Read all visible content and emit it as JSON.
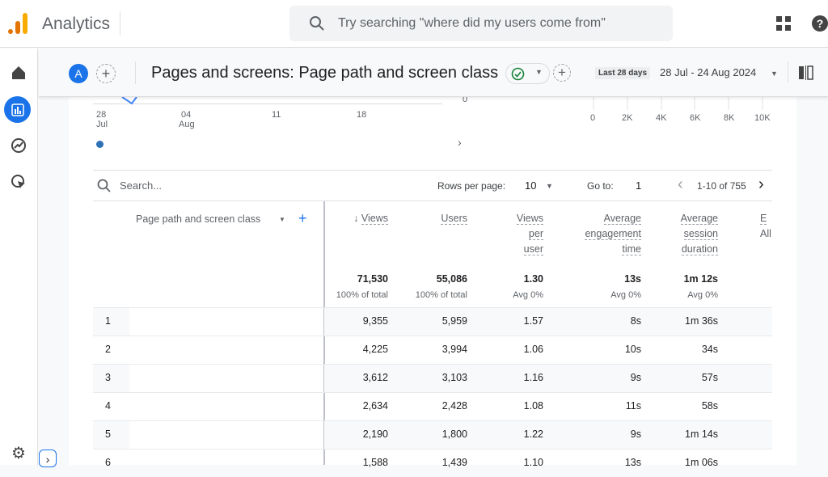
{
  "app": {
    "name": "Analytics",
    "search_placeholder": "Try searching \"where did my users come from\""
  },
  "subheader": {
    "avatar": "A",
    "title": "Pages and screens: Page path and screen class",
    "date_chip": "Last 28 days",
    "date_range": "28 Jul - 24 Aug 2024"
  },
  "chart": {
    "x_ticks": [
      "28",
      "Jul",
      "04",
      "Aug",
      "11",
      "18"
    ],
    "y_zero": "0",
    "bar_ticks": [
      "0",
      "2K",
      "4K",
      "6K",
      "8K",
      "10K"
    ]
  },
  "table": {
    "search_placeholder": "Search...",
    "rows_per_page_label": "Rows per page:",
    "rows_per_page": "10",
    "goto_label": "Go to:",
    "goto": "1",
    "pagination": "1-10 of 755",
    "dimension_header": "Page path and screen class",
    "headers": [
      [
        "Views"
      ],
      [
        "Users"
      ],
      [
        "Views",
        "per",
        "user"
      ],
      [
        "Average",
        "engagement",
        "time"
      ],
      [
        "Average",
        "session",
        "duration"
      ],
      [
        "E",
        "All"
      ]
    ],
    "totals": [
      [
        "71,530",
        "100% of total"
      ],
      [
        "55,086",
        "100% of total"
      ],
      [
        "1.30",
        "Avg 0%"
      ],
      [
        "13s",
        "Avg 0%"
      ],
      [
        "1m 12s",
        "Avg 0%"
      ]
    ],
    "rows": [
      [
        "1",
        "9,355",
        "5,959",
        "1.57",
        "8s",
        "1m 36s"
      ],
      [
        "2",
        "4,225",
        "3,994",
        "1.06",
        "10s",
        "34s"
      ],
      [
        "3",
        "3,612",
        "3,103",
        "1.16",
        "9s",
        "57s"
      ],
      [
        "4",
        "2,634",
        "2,428",
        "1.08",
        "11s",
        "58s"
      ],
      [
        "5",
        "2,190",
        "1,800",
        "1.22",
        "9s",
        "1m 14s"
      ],
      [
        "6",
        "1,588",
        "1,439",
        "1.10",
        "13s",
        "1m 06s"
      ]
    ]
  },
  "colors": {
    "accent": "#1a73e8",
    "logo_orange": "#f9ab00",
    "logo_dark": "#e37400",
    "check": "#188038"
  }
}
